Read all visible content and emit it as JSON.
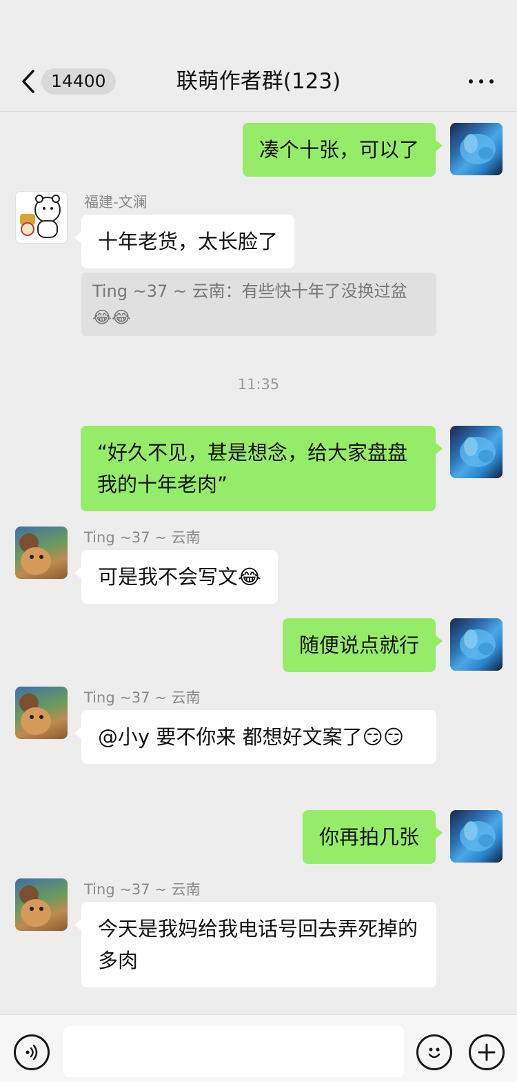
{
  "header": {
    "unread_count": "14400",
    "title": "联萌作者群(123)"
  },
  "messages": [
    {
      "from": "me",
      "text": "凑个十张，可以了"
    },
    {
      "from": "them",
      "sender": "福建-文澜",
      "text": "十年老货，太长脸了",
      "quote": "Ting ~37 ~ 云南：有些快十年了没换过盆😂😂"
    },
    {
      "type": "time",
      "text": "11:35"
    },
    {
      "from": "me",
      "text": "“好久不见，甚是想念，给大家盘盘我的十年老肉”"
    },
    {
      "from": "them",
      "sender": "Ting ~37 ~ 云南",
      "text": "可是我不会写文😂"
    },
    {
      "from": "me",
      "text": "随便说点就行"
    },
    {
      "from": "them",
      "sender": "Ting ~37 ~ 云南",
      "text": "@小y 要不你来 都想好文案了😏😏"
    },
    {
      "from": "me",
      "text": "你再拍几张"
    },
    {
      "from": "them",
      "sender": "Ting ~37 ~ 云南",
      "text": "今天是我妈给我电话号回去弄死掉的多肉"
    }
  ],
  "input": {
    "value": ""
  },
  "colors": {
    "background": "#ededed",
    "bubble_me": "#95ec69",
    "bubble_them": "#ffffff"
  },
  "icons": {
    "back": "chevron-left-icon",
    "more": "more-icon",
    "voice": "voice-icon",
    "emoji": "emoji-icon",
    "plus": "plus-icon"
  }
}
